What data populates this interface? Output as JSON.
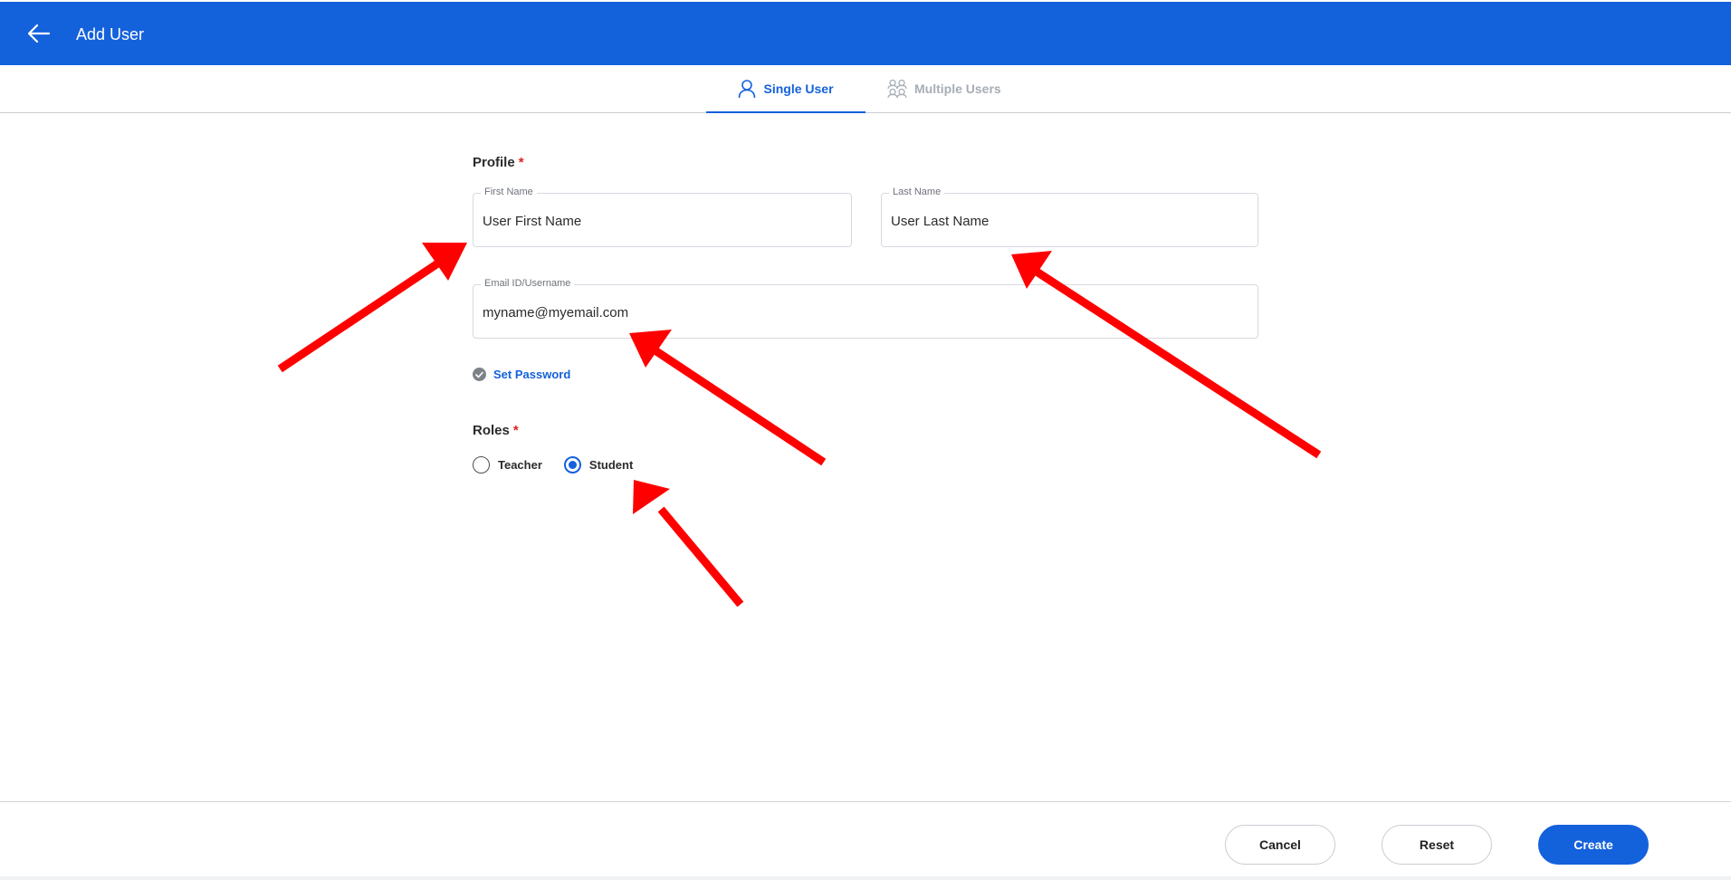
{
  "header": {
    "title": "Add User",
    "background": "#1461dc",
    "back_icon": "arrow-left-icon"
  },
  "tabs": [
    {
      "label": "Single User",
      "icon": "user-icon",
      "active": true
    },
    {
      "label": "Multiple Users",
      "icon": "users-icon",
      "active": false
    }
  ],
  "profile": {
    "label": "Profile",
    "required_mark": "*",
    "first_name": {
      "label": "First Name",
      "value": "User First Name"
    },
    "last_name": {
      "label": "Last Name",
      "value": "User Last Name"
    },
    "email": {
      "label": "Email ID/Username",
      "value": "myname@myemail.com"
    }
  },
  "set_password": {
    "label": "Set Password",
    "icon": "check-circle-icon"
  },
  "roles": {
    "label": "Roles",
    "required_mark": "*",
    "options": [
      {
        "label": "Teacher",
        "checked": false
      },
      {
        "label": "Student",
        "checked": true
      }
    ]
  },
  "footer": {
    "cancel_label": "Cancel",
    "reset_label": "Reset",
    "create_label": "Create"
  },
  "annotations": {
    "arrow_color": "#ff0000"
  }
}
